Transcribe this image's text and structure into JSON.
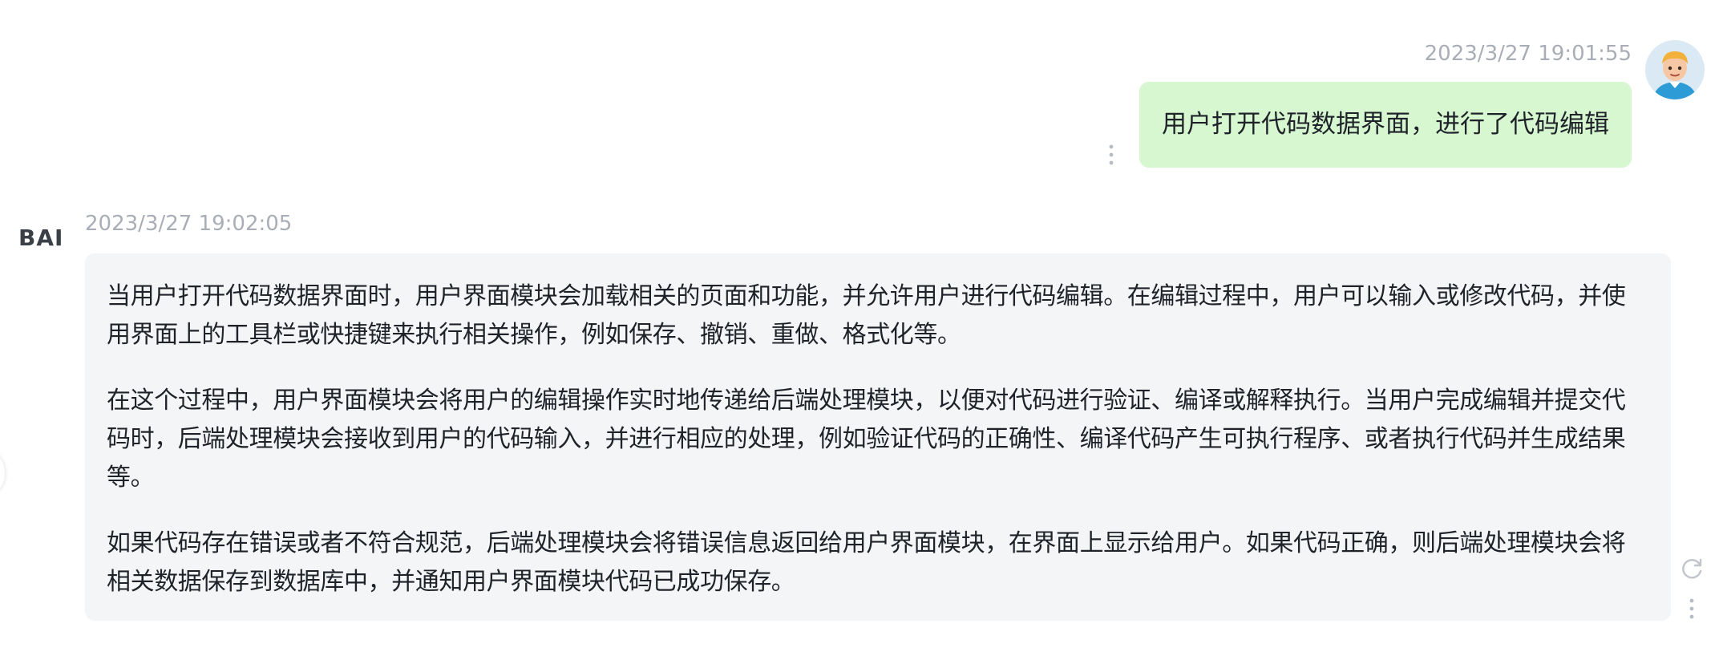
{
  "user_message": {
    "timestamp": "2023/3/27 19:01:55",
    "text": "用户打开代码数据界面，进行了代码编辑",
    "bubble_color": "#d6f7d0"
  },
  "bot_message": {
    "logo": "BAI",
    "timestamp": "2023/3/27 19:02:05",
    "bubble_color": "#f4f5f7",
    "paragraphs": [
      "当用户打开代码数据界面时，用户界面模块会加载相关的页面和功能，并允许用户进行代码编辑。在编辑过程中，用户可以输入或修改代码，并使用界面上的工具栏或快捷键来执行相关操作，例如保存、撤销、重做、格式化等。",
      "在这个过程中，用户界面模块会将用户的编辑操作实时地传递给后端处理模块，以便对代码进行验证、编译或解释执行。当用户完成编辑并提交代码时，后端处理模块会接收到用户的代码输入，并进行相应的处理，例如验证代码的正确性、编译代码产生可执行程序、或者执行代码并生成结果等。",
      "如果代码存在错误或者不符合规范，后端处理模块会将错误信息返回给用户界面模块，在界面上显示给用户。如果代码正确，则后端处理模块会将相关数据保存到数据库中，并通知用户界面模块代码已成功保存。"
    ]
  },
  "icons": {
    "user_avatar": "user-avatar-icon",
    "user_more": "more-vertical-icon",
    "bot_more": "more-vertical-icon",
    "retry": "refresh-icon"
  }
}
